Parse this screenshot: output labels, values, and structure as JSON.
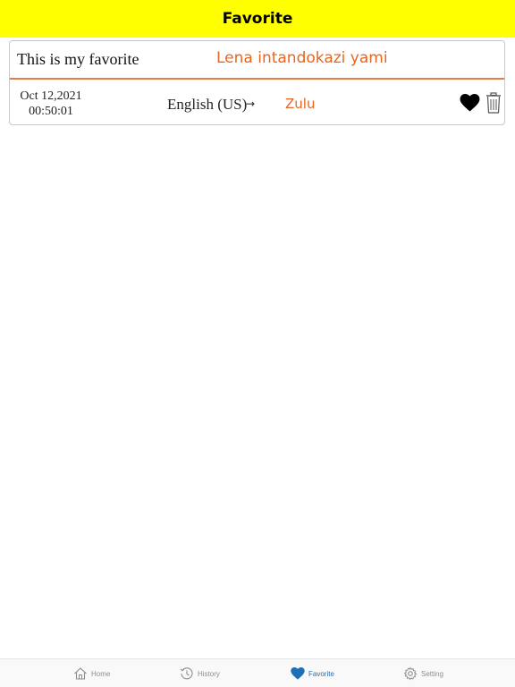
{
  "nav": {
    "title": "Favorite"
  },
  "favorites": [
    {
      "source_text": "This is my favorite",
      "translated_text": "Lena intandokazi yami",
      "date": "Oct 12,2021",
      "time": "00:50:01",
      "from_language": "English (US)",
      "arrow": "→",
      "to_language": "Zulu",
      "favorite_icon": "heart-icon",
      "delete_icon": "trash-icon"
    }
  ],
  "tabs": [
    {
      "label": "Home",
      "icon": "home-icon",
      "active": false
    },
    {
      "label": "History",
      "icon": "history-icon",
      "active": false
    },
    {
      "label": "Favorite",
      "icon": "heart-icon",
      "active": true
    },
    {
      "label": "Setting",
      "icon": "gear-icon",
      "active": false
    }
  ],
  "colors": {
    "nav_background": "#ffff00",
    "accent_orange": "#e8661e",
    "divider_orange": "#e87d3e",
    "tab_active": "#1f6fb6",
    "tab_inactive": "#8e8e8e"
  }
}
